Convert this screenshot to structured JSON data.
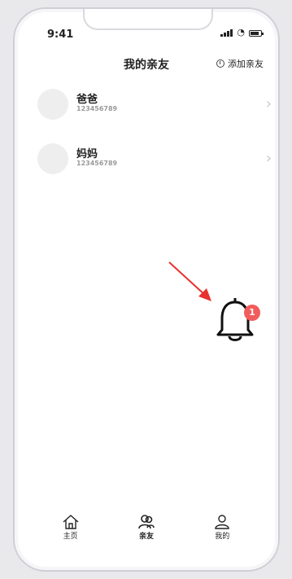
{
  "status": {
    "time": "9:41"
  },
  "header": {
    "title": "我的亲友",
    "add_label": "添加亲友"
  },
  "contacts": [
    {
      "name": "爸爸",
      "phone": "123456789"
    },
    {
      "name": "妈妈",
      "phone": "123456789"
    }
  ],
  "notification": {
    "badge_count": "1"
  },
  "tabs": [
    {
      "label": "主页",
      "icon": "home-icon"
    },
    {
      "label": "亲友",
      "icon": "friends-icon"
    },
    {
      "label": "我的",
      "icon": "profile-icon"
    }
  ],
  "colors": {
    "badge": "#f25c5c",
    "arrow": "#e8312e",
    "avatar": "#eeeeee"
  }
}
